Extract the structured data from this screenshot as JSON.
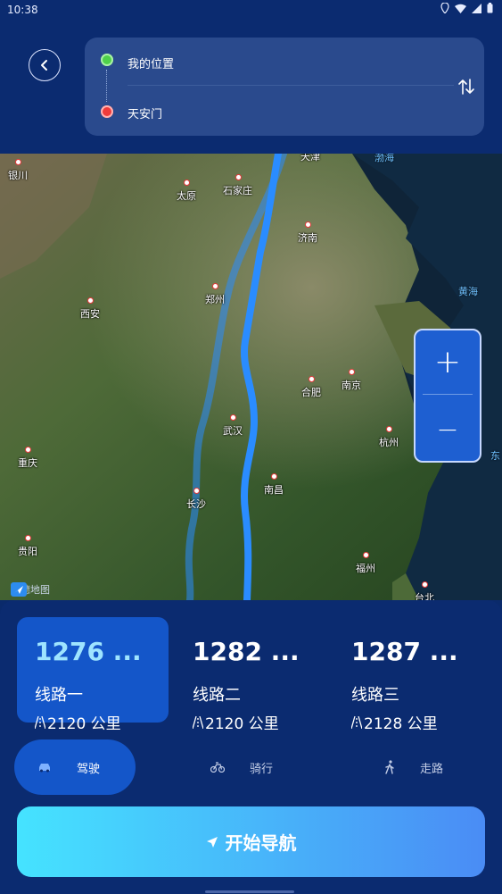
{
  "status": {
    "time": "10:38"
  },
  "header": {
    "from_label": "我的位置",
    "to_label": "天安门"
  },
  "map": {
    "cities": [
      "银川",
      "太原",
      "石家庄",
      "天津",
      "济南",
      "郑州",
      "西安",
      "合肥",
      "南京",
      "武汉",
      "杭州",
      "重庆",
      "长沙",
      "南昌",
      "贵阳",
      "福州",
      "台北"
    ],
    "seas": [
      "黄海",
      "渤海",
      "东"
    ],
    "logo": "高德地图",
    "zoom_in": "+",
    "zoom_out": "−"
  },
  "routes": [
    {
      "time": "1276 ...",
      "name": "线路一",
      "distance": "2120 公里",
      "selected": true
    },
    {
      "time": "1282 ...",
      "name": "线路二",
      "distance": "2120 公里",
      "selected": false
    },
    {
      "time": "1287 ...",
      "name": "线路三",
      "distance": "2128 公里",
      "selected": false
    }
  ],
  "modes": [
    {
      "label": "驾驶",
      "icon": "car-icon",
      "selected": true
    },
    {
      "label": "骑行",
      "icon": "bike-icon",
      "selected": false
    },
    {
      "label": "走路",
      "icon": "walk-icon",
      "selected": false
    }
  ],
  "start_button": "开始导航",
  "colors": {
    "accent": "#1456c9",
    "route": "#2a8cff",
    "start_from": "#45e3ff",
    "start_to": "#4a8cf5"
  }
}
